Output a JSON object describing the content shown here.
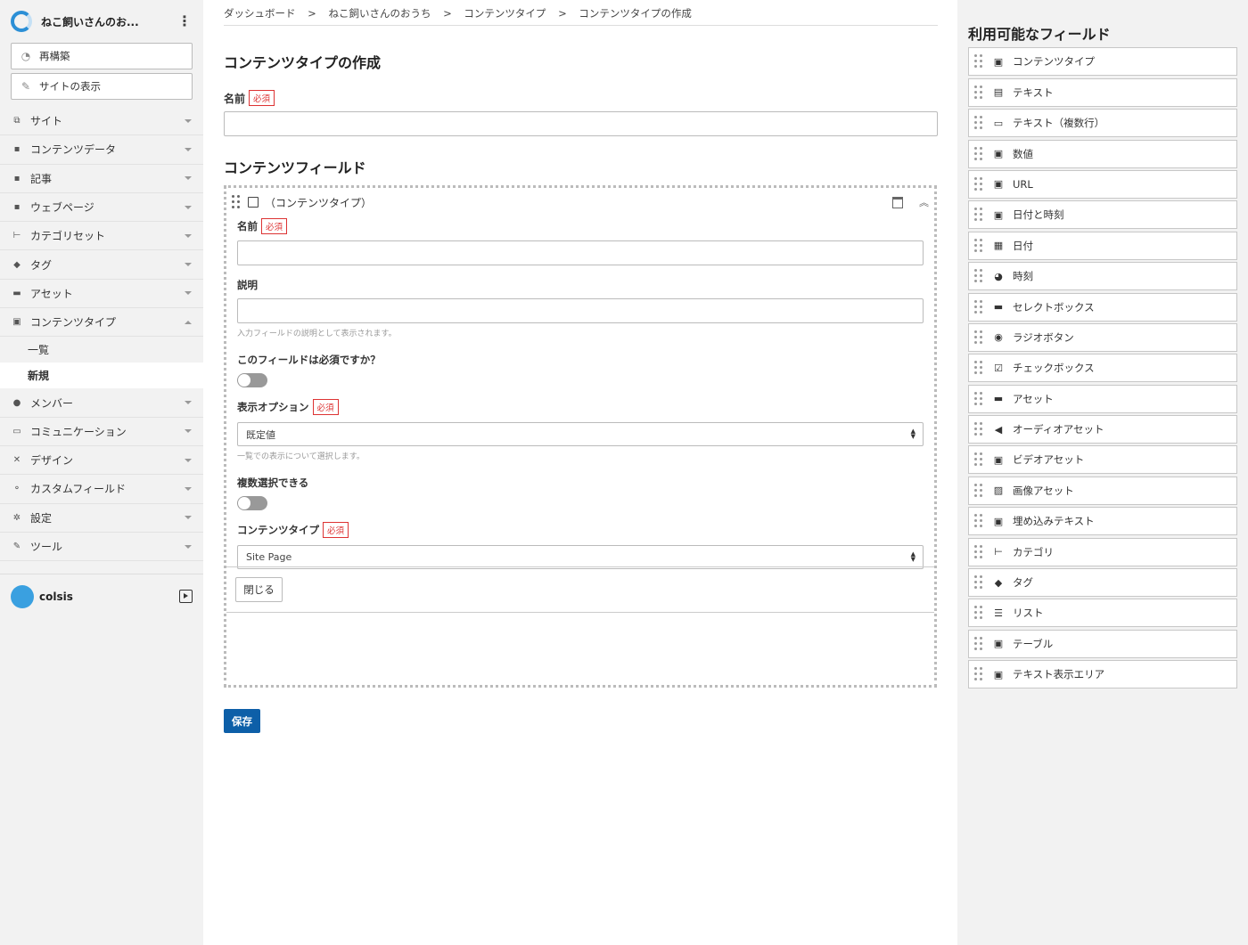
{
  "sidebar": {
    "site_name": "ねこ飼いさんのお...",
    "rebuild_label": "再構築",
    "view_site_label": "サイトの表示",
    "nav": [
      {
        "label": "サイト",
        "icon": "site-icon",
        "glyph": "⧉"
      },
      {
        "label": "コンテンツデータ",
        "icon": "content-data-icon",
        "glyph": "▪"
      },
      {
        "label": "記事",
        "icon": "entry-icon",
        "glyph": "▪"
      },
      {
        "label": "ウェブページ",
        "icon": "webpage-icon",
        "glyph": "▪"
      },
      {
        "label": "カテゴリセット",
        "icon": "category-set-icon",
        "glyph": "⊢"
      },
      {
        "label": "タグ",
        "icon": "tag-icon",
        "glyph": "◆"
      },
      {
        "label": "アセット",
        "icon": "asset-icon",
        "glyph": "▬"
      },
      {
        "label": "コンテンツタイプ",
        "icon": "content-type-icon",
        "glyph": "▣"
      },
      {
        "label": "メンバー",
        "icon": "member-icon",
        "glyph": "●"
      },
      {
        "label": "コミュニケーション",
        "icon": "communication-icon",
        "glyph": "▭"
      },
      {
        "label": "デザイン",
        "icon": "design-icon",
        "glyph": "✕"
      },
      {
        "label": "カスタムフィールド",
        "icon": "custom-field-icon",
        "glyph": "⚬"
      },
      {
        "label": "設定",
        "icon": "settings-icon",
        "glyph": "✲"
      },
      {
        "label": "ツール",
        "icon": "tool-icon",
        "glyph": "✎"
      }
    ],
    "sub_items": [
      "一覧",
      "新規"
    ],
    "user_name": "colsis"
  },
  "breadcrumb": [
    "ダッシュボード",
    ">",
    "ねこ飼いさんのおうち",
    ">",
    "コンテンツタイプ",
    ">",
    "コンテンツタイプの作成"
  ],
  "main": {
    "title": "コンテンツタイプの作成",
    "name_label": "名前",
    "required_badge": "必須",
    "name_value": "",
    "fields_title": "コンテンツフィールド",
    "card": {
      "title": "（コンテンツタイプ）",
      "name_label": "名前",
      "name_value": "",
      "desc_label": "説明",
      "desc_value": "",
      "desc_hint": "入力フィールドの説明として表示されます。",
      "required_question": "このフィールドは必須ですか？",
      "display_label": "表示オプション",
      "display_value": "既定値",
      "display_hint": "一覧での表示について選択します。",
      "multi_label": "複数選択できる",
      "ct_label": "コンテンツタイプ",
      "ct_value": "Site Page",
      "close_label": "閉じる"
    },
    "save_label": "保存"
  },
  "right_panel": {
    "title": "利用可能なフィールド",
    "types": [
      {
        "label": "コンテンツタイプ",
        "icon": "content-type-icon",
        "glyph": "▣"
      },
      {
        "label": "テキスト",
        "icon": "text-icon",
        "glyph": "▤"
      },
      {
        "label": "テキスト（複数行）",
        "icon": "multiline-text-icon",
        "glyph": "▭"
      },
      {
        "label": "数値",
        "icon": "number-icon",
        "glyph": "▣"
      },
      {
        "label": "URL",
        "icon": "url-icon",
        "glyph": "▣"
      },
      {
        "label": "日付と時刻",
        "icon": "datetime-icon",
        "glyph": "▣"
      },
      {
        "label": "日付",
        "icon": "calendar-icon",
        "glyph": "▦"
      },
      {
        "label": "時刻",
        "icon": "clock-icon",
        "glyph": "◕"
      },
      {
        "label": "セレクトボックス",
        "icon": "select-box-icon",
        "glyph": "▬"
      },
      {
        "label": "ラジオボタン",
        "icon": "radio-icon",
        "glyph": "◉"
      },
      {
        "label": "チェックボックス",
        "icon": "checkbox-icon",
        "glyph": "☑"
      },
      {
        "label": "アセット",
        "icon": "asset-icon",
        "glyph": "▬"
      },
      {
        "label": "オーディオアセット",
        "icon": "audio-icon",
        "glyph": "◀"
      },
      {
        "label": "ビデオアセット",
        "icon": "video-icon",
        "glyph": "▣"
      },
      {
        "label": "画像アセット",
        "icon": "image-icon",
        "glyph": "▨"
      },
      {
        "label": "埋め込みテキスト",
        "icon": "embed-text-icon",
        "glyph": "▣"
      },
      {
        "label": "カテゴリ",
        "icon": "category-icon",
        "glyph": "⊢"
      },
      {
        "label": "タグ",
        "icon": "tag-icon",
        "glyph": "◆"
      },
      {
        "label": "リスト",
        "icon": "list-icon",
        "glyph": "☰"
      },
      {
        "label": "テーブル",
        "icon": "table-icon",
        "glyph": "▣"
      },
      {
        "label": "テキスト表示エリア",
        "icon": "text-area-icon",
        "glyph": "▣"
      }
    ]
  }
}
